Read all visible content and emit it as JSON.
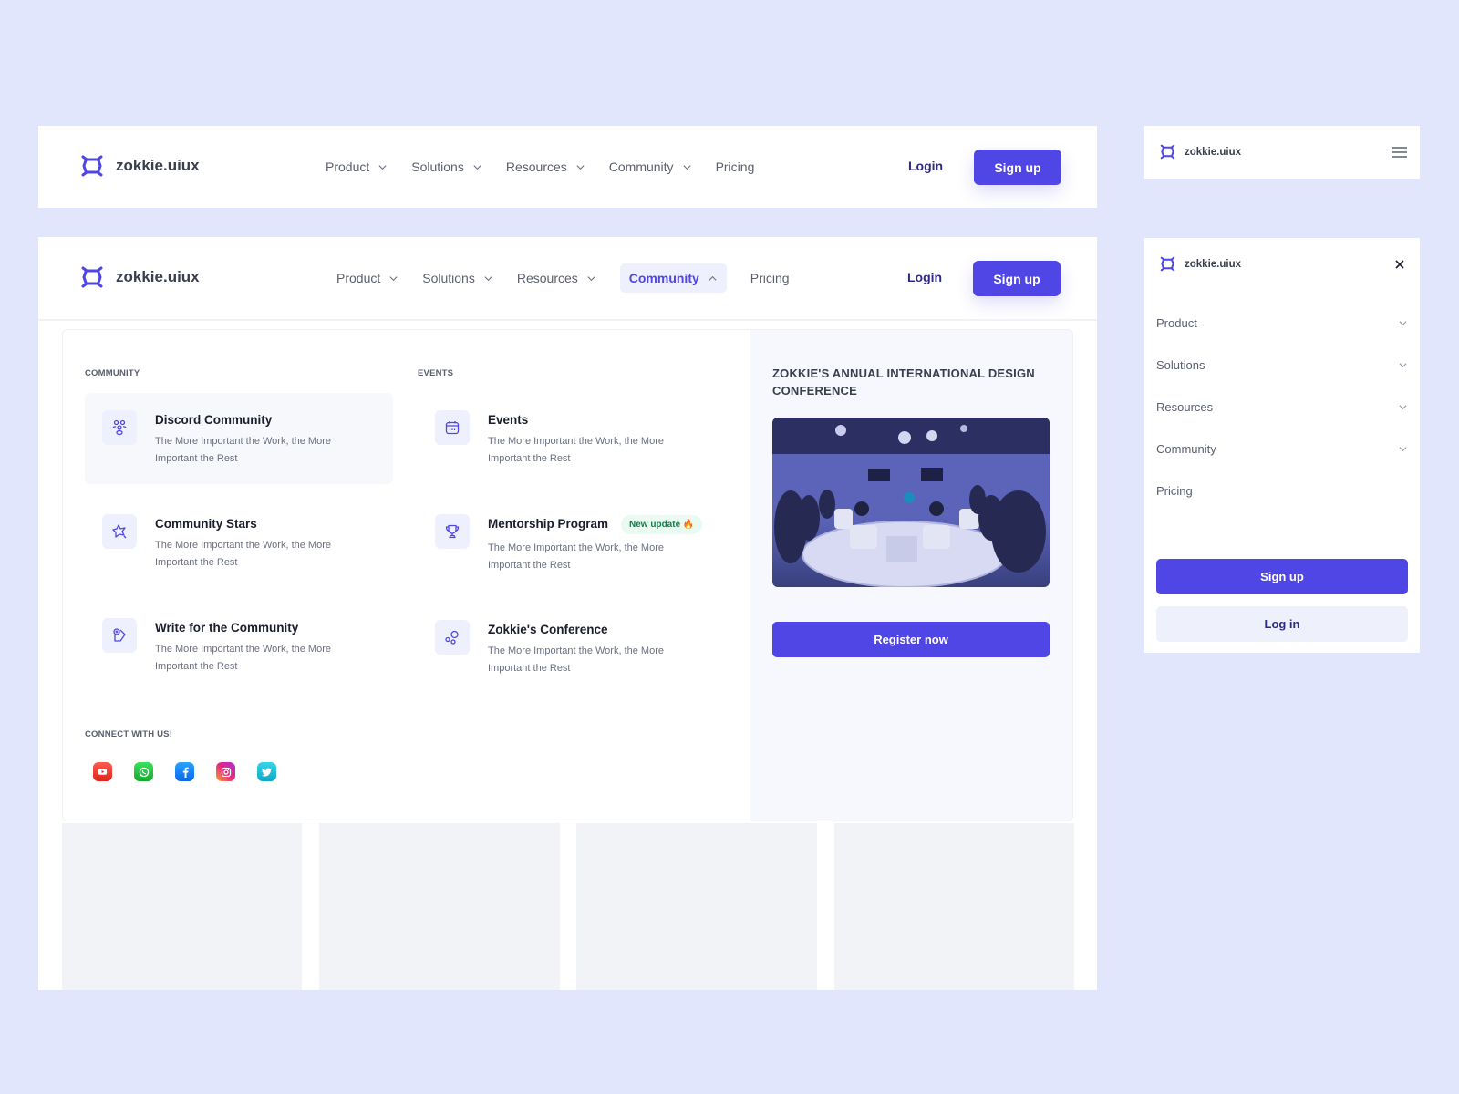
{
  "brand": {
    "name": "zokkie.uiux",
    "accent": "#4f46e5",
    "background": "#e1e6fd"
  },
  "nav": {
    "items": [
      {
        "label": "Product",
        "has_dropdown": true
      },
      {
        "label": "Solutions",
        "has_dropdown": true
      },
      {
        "label": "Resources",
        "has_dropdown": true
      },
      {
        "label": "Community",
        "has_dropdown": true
      },
      {
        "label": "Pricing",
        "has_dropdown": false
      }
    ],
    "active_item": "Community",
    "login_label": "Login",
    "signup_label": "Sign up"
  },
  "community_menu": {
    "community_section": {
      "label": "COMMUNITY",
      "items": [
        {
          "title": "Discord Community",
          "description": "The More Important the Work, the More Important the Rest",
          "icon": "users-group-icon"
        },
        {
          "title": "Community Stars",
          "description": "The More Important the Work, the More Important the Rest",
          "icon": "star-icon"
        },
        {
          "title": "Write for the Community",
          "description": "The More Important the Work, the More Important the Rest",
          "icon": "write-icon"
        }
      ]
    },
    "events_section": {
      "label": "EVENTS",
      "items": [
        {
          "title": "Events",
          "description": "The More Important the Work, the More Important the Rest",
          "icon": "calendar-icon"
        },
        {
          "title": "Mentorship Program",
          "description": "The More Important the Work, the More Important the Rest",
          "icon": "trophy-icon",
          "badge": "New update 🔥"
        },
        {
          "title": "Zokkie's Conference",
          "description": "The More Important the Work, the More Important the Rest",
          "icon": "bubbles-icon"
        }
      ]
    },
    "connect": {
      "label": "CONNECT WITH US!",
      "socials": [
        "youtube",
        "whatsapp",
        "facebook",
        "instagram",
        "twitter"
      ]
    },
    "feature": {
      "title": "ZOKKIE'S ANNUAL INTERNATIONAL DESIGN CONFERENCE",
      "image_alt": "Conference panel discussion on a round stage with audience",
      "cta_label": "Register now"
    }
  },
  "mobile": {
    "menu": [
      {
        "label": "Product",
        "has_dropdown": true
      },
      {
        "label": "Solutions",
        "has_dropdown": true
      },
      {
        "label": "Resources",
        "has_dropdown": true
      },
      {
        "label": "Community",
        "has_dropdown": true
      },
      {
        "label": "Pricing",
        "has_dropdown": false
      }
    ],
    "signup_label": "Sign up",
    "login_label": "Log in"
  }
}
